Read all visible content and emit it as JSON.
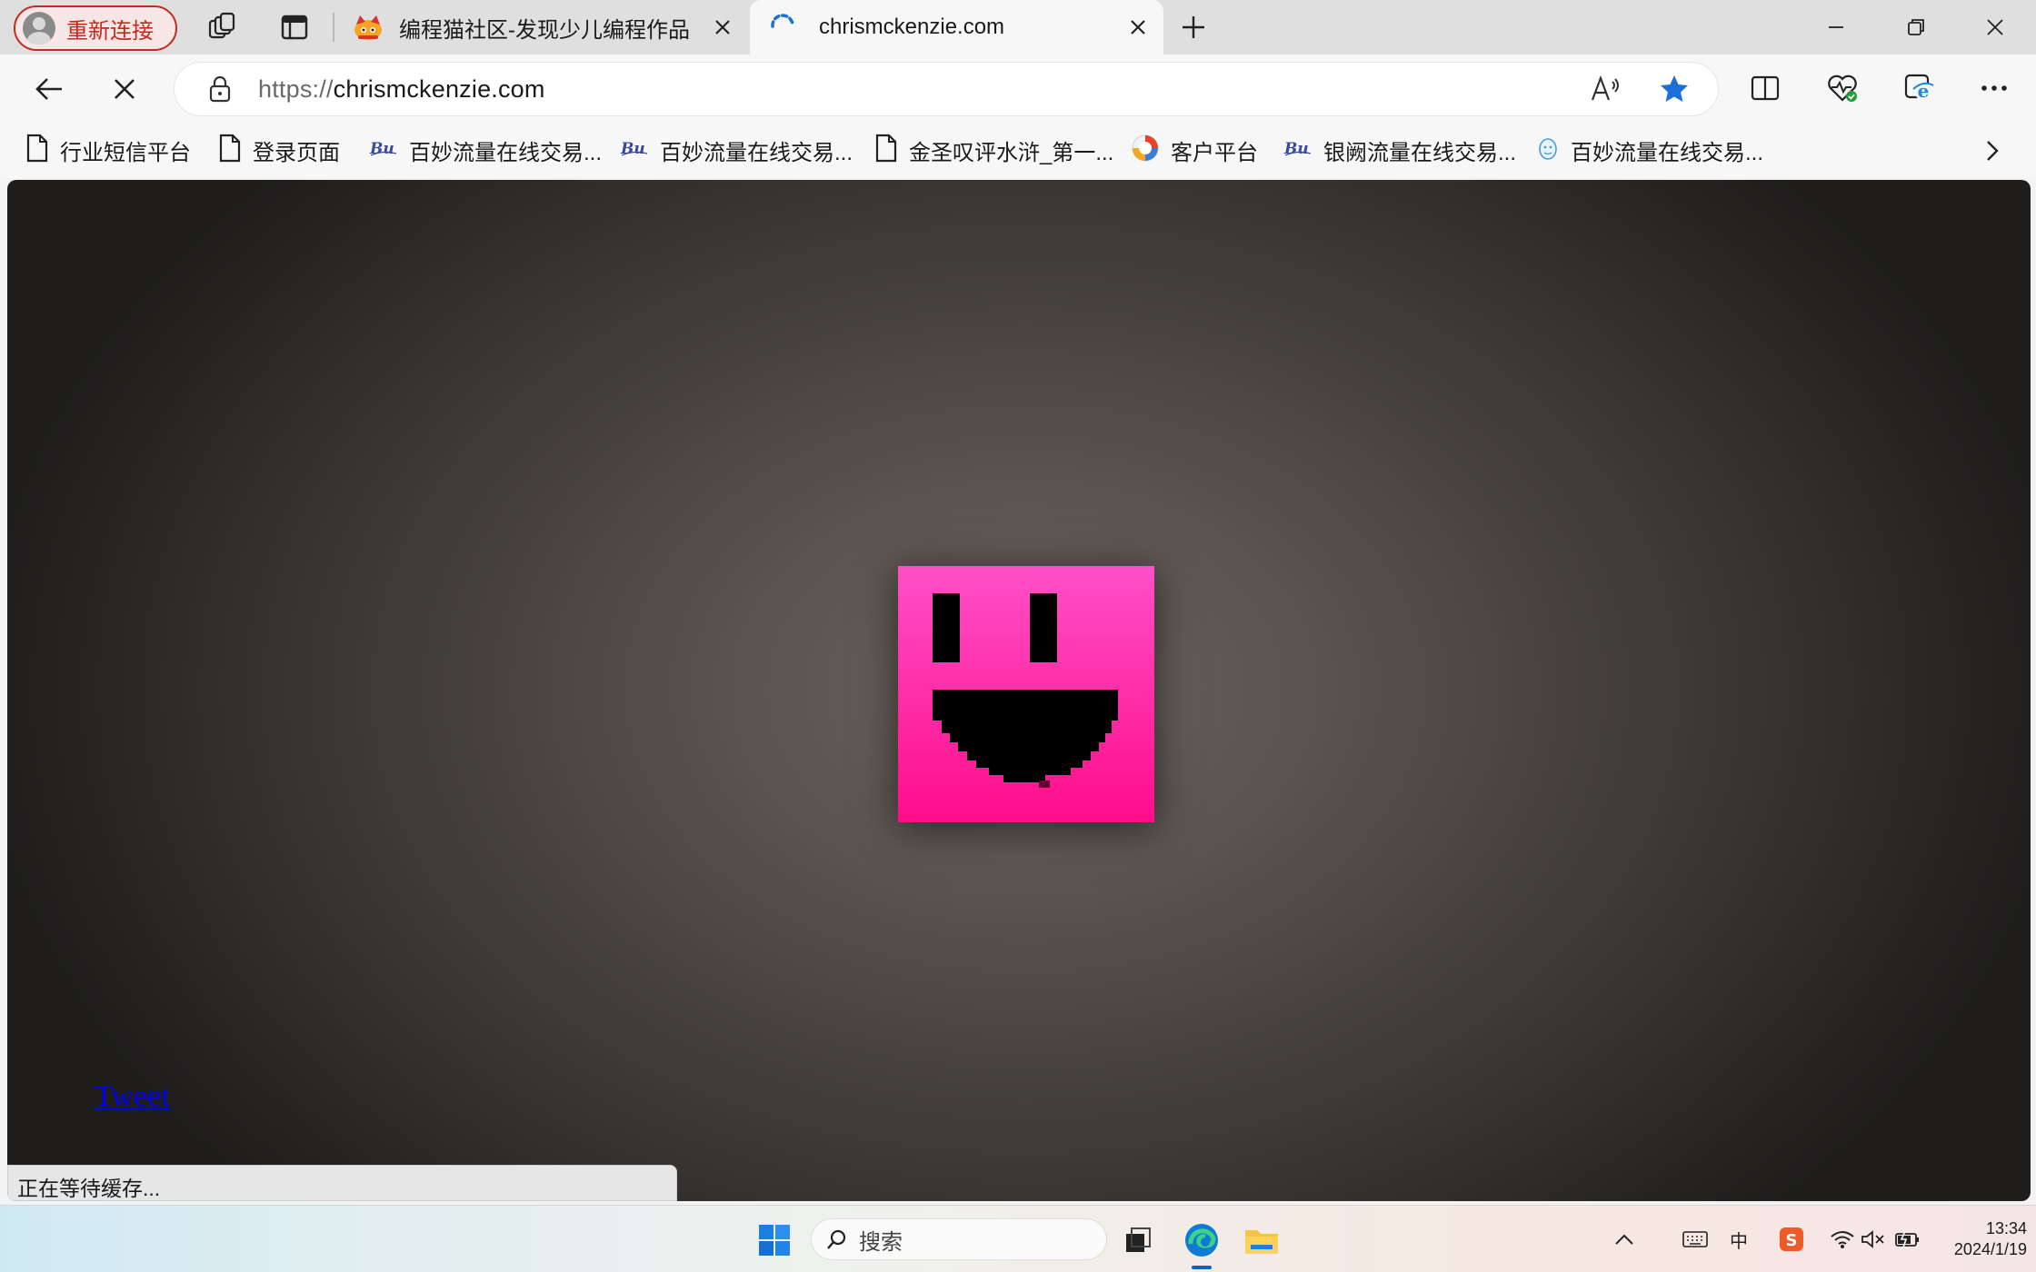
{
  "browser": {
    "profile_label": "重新连接",
    "tabs": [
      {
        "title": "编程猫社区-发现少儿编程作品",
        "active": false
      },
      {
        "title": "chrismckenzie.com",
        "active": true
      }
    ],
    "url": {
      "scheme": "https://",
      "host": "chrismckenzie.com"
    },
    "accent_color": "#1a6fd8"
  },
  "favorites": [
    {
      "label": "行业短信平台",
      "icon": "page-icon"
    },
    {
      "label": "登录页面",
      "icon": "page-icon"
    },
    {
      "label": "百妙流量在线交易...",
      "icon": "brand-logo-icon"
    },
    {
      "label": "百妙流量在线交易...",
      "icon": "brand-logo-icon"
    },
    {
      "label": "金圣叹评水浒_第一...",
      "icon": "page-icon"
    },
    {
      "label": "客户平台",
      "icon": "colorful-logo-icon"
    },
    {
      "label": "银阙流量在线交易...",
      "icon": "brand-logo-icon"
    },
    {
      "label": "百妙流量在线交易...",
      "icon": "face-logo-icon"
    }
  ],
  "page": {
    "tweet_label": "Tweet",
    "status_text": "正在等待缓存...",
    "smiley_color": "#ff1aa5"
  },
  "taskbar": {
    "search_label": "搜索",
    "ime_label": "中",
    "time": "13:34",
    "date": "2024/1/19"
  }
}
